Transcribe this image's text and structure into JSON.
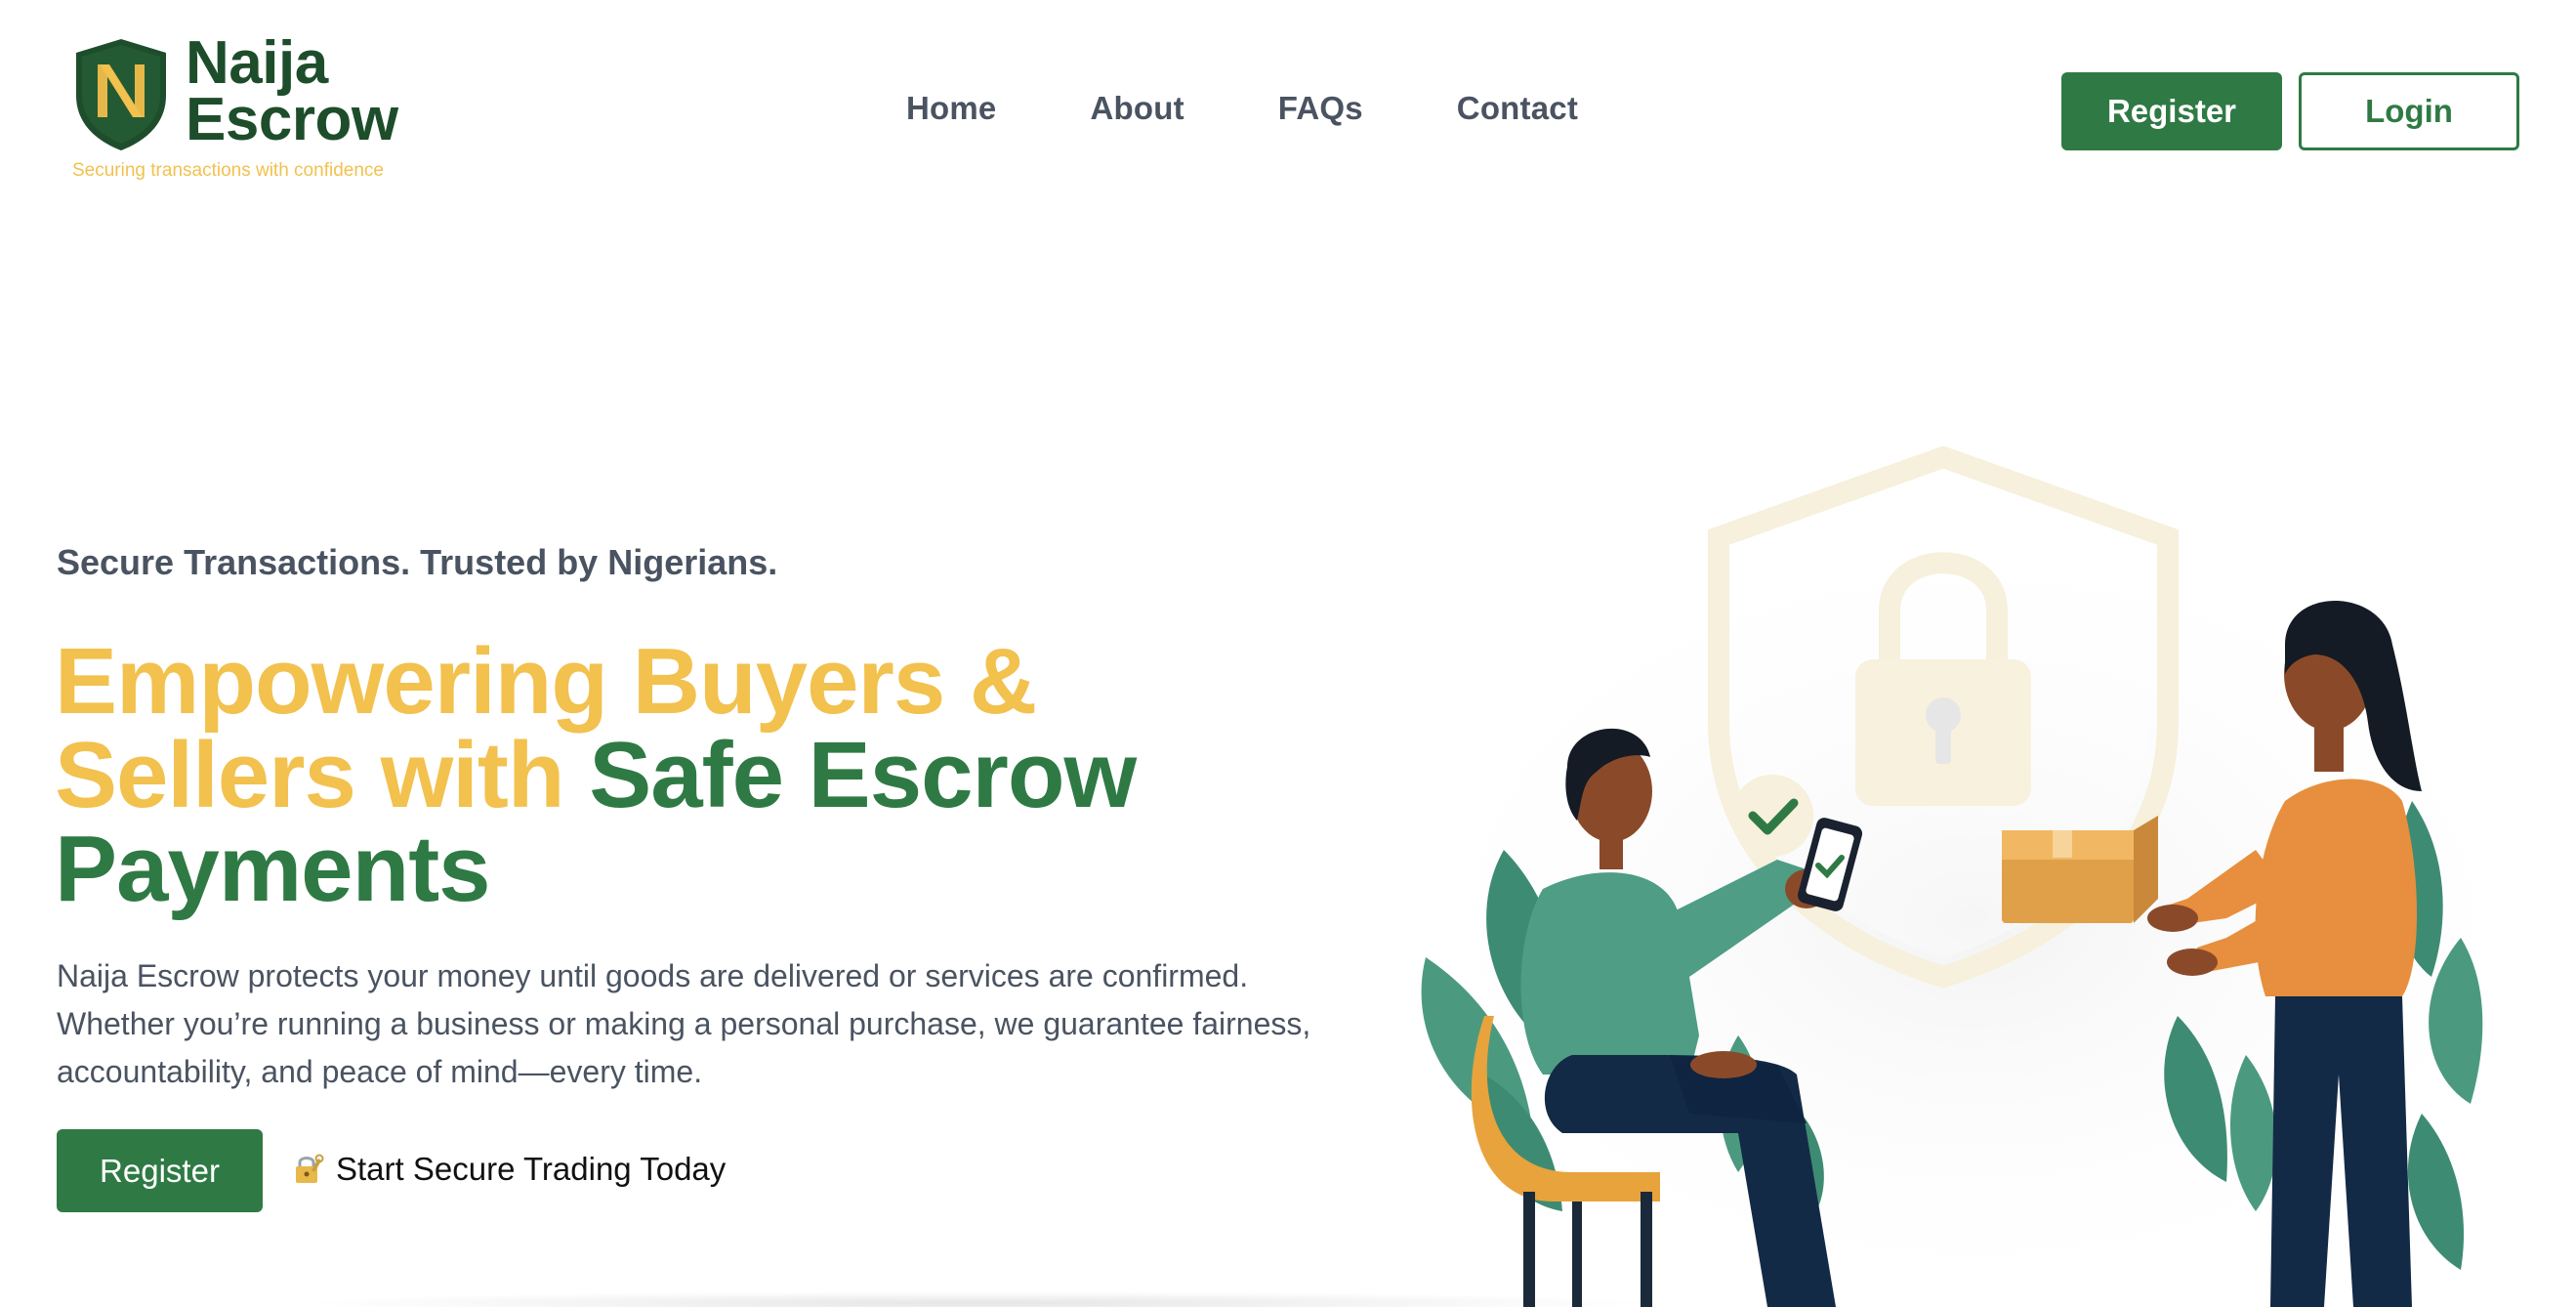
{
  "brand": {
    "name_line1": "Naija",
    "name_line2": "Escrow",
    "tagline": "Securing transactions with confidence",
    "logo_icon": "shield-n-icon"
  },
  "nav": {
    "items": [
      {
        "label": "Home"
      },
      {
        "label": "About"
      },
      {
        "label": "FAQs"
      },
      {
        "label": "Contact"
      }
    ]
  },
  "header_actions": {
    "register_label": "Register",
    "login_label": "Login"
  },
  "hero": {
    "subtitle": "Secure Transactions. Trusted by Nigerians.",
    "title_part1": "Empowering Buyers &",
    "title_part2": "Sellers with ",
    "title_part3": "Safe Escrow",
    "title_part4": "Payments",
    "description": "Naija Escrow protects your money until goods are delivered or services are confirmed. Whether you’re running a business or making a personal purchase, we guarantee fairness, accountability, and peace of mind—every time.",
    "register_label": "Register",
    "cta_icon": "lock-with-key-icon",
    "cta_text": "Start Secure Trading Today",
    "illustration": "buyer-seller-escrow-illustration"
  },
  "colors": {
    "primary_green": "#2f7a44",
    "dark_green": "#1e4d2b",
    "accent_yellow": "#f2c14e",
    "text_gray": "#4a5361"
  }
}
